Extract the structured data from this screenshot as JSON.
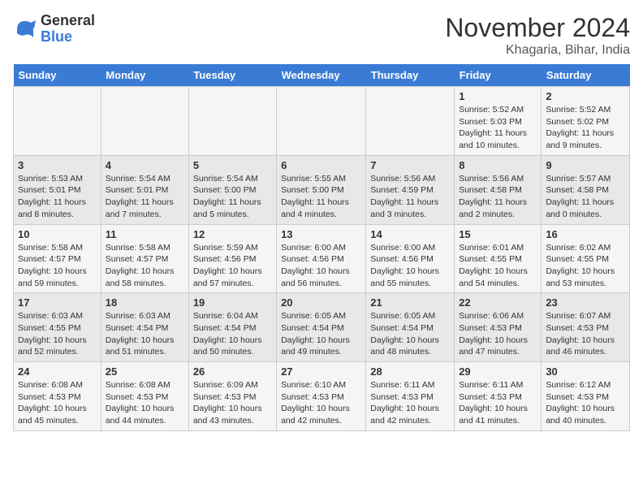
{
  "logo": {
    "general": "General",
    "blue": "Blue"
  },
  "title": "November 2024",
  "location": "Khagaria, Bihar, India",
  "headers": [
    "Sunday",
    "Monday",
    "Tuesday",
    "Wednesday",
    "Thursday",
    "Friday",
    "Saturday"
  ],
  "weeks": [
    [
      {
        "day": "",
        "info": ""
      },
      {
        "day": "",
        "info": ""
      },
      {
        "day": "",
        "info": ""
      },
      {
        "day": "",
        "info": ""
      },
      {
        "day": "",
        "info": ""
      },
      {
        "day": "1",
        "info": "Sunrise: 5:52 AM\nSunset: 5:03 PM\nDaylight: 11 hours and 10 minutes."
      },
      {
        "day": "2",
        "info": "Sunrise: 5:52 AM\nSunset: 5:02 PM\nDaylight: 11 hours and 9 minutes."
      }
    ],
    [
      {
        "day": "3",
        "info": "Sunrise: 5:53 AM\nSunset: 5:01 PM\nDaylight: 11 hours and 8 minutes."
      },
      {
        "day": "4",
        "info": "Sunrise: 5:54 AM\nSunset: 5:01 PM\nDaylight: 11 hours and 7 minutes."
      },
      {
        "day": "5",
        "info": "Sunrise: 5:54 AM\nSunset: 5:00 PM\nDaylight: 11 hours and 5 minutes."
      },
      {
        "day": "6",
        "info": "Sunrise: 5:55 AM\nSunset: 5:00 PM\nDaylight: 11 hours and 4 minutes."
      },
      {
        "day": "7",
        "info": "Sunrise: 5:56 AM\nSunset: 4:59 PM\nDaylight: 11 hours and 3 minutes."
      },
      {
        "day": "8",
        "info": "Sunrise: 5:56 AM\nSunset: 4:58 PM\nDaylight: 11 hours and 2 minutes."
      },
      {
        "day": "9",
        "info": "Sunrise: 5:57 AM\nSunset: 4:58 PM\nDaylight: 11 hours and 0 minutes."
      }
    ],
    [
      {
        "day": "10",
        "info": "Sunrise: 5:58 AM\nSunset: 4:57 PM\nDaylight: 10 hours and 59 minutes."
      },
      {
        "day": "11",
        "info": "Sunrise: 5:58 AM\nSunset: 4:57 PM\nDaylight: 10 hours and 58 minutes."
      },
      {
        "day": "12",
        "info": "Sunrise: 5:59 AM\nSunset: 4:56 PM\nDaylight: 10 hours and 57 minutes."
      },
      {
        "day": "13",
        "info": "Sunrise: 6:00 AM\nSunset: 4:56 PM\nDaylight: 10 hours and 56 minutes."
      },
      {
        "day": "14",
        "info": "Sunrise: 6:00 AM\nSunset: 4:56 PM\nDaylight: 10 hours and 55 minutes."
      },
      {
        "day": "15",
        "info": "Sunrise: 6:01 AM\nSunset: 4:55 PM\nDaylight: 10 hours and 54 minutes."
      },
      {
        "day": "16",
        "info": "Sunrise: 6:02 AM\nSunset: 4:55 PM\nDaylight: 10 hours and 53 minutes."
      }
    ],
    [
      {
        "day": "17",
        "info": "Sunrise: 6:03 AM\nSunset: 4:55 PM\nDaylight: 10 hours and 52 minutes."
      },
      {
        "day": "18",
        "info": "Sunrise: 6:03 AM\nSunset: 4:54 PM\nDaylight: 10 hours and 51 minutes."
      },
      {
        "day": "19",
        "info": "Sunrise: 6:04 AM\nSunset: 4:54 PM\nDaylight: 10 hours and 50 minutes."
      },
      {
        "day": "20",
        "info": "Sunrise: 6:05 AM\nSunset: 4:54 PM\nDaylight: 10 hours and 49 minutes."
      },
      {
        "day": "21",
        "info": "Sunrise: 6:05 AM\nSunset: 4:54 PM\nDaylight: 10 hours and 48 minutes."
      },
      {
        "day": "22",
        "info": "Sunrise: 6:06 AM\nSunset: 4:53 PM\nDaylight: 10 hours and 47 minutes."
      },
      {
        "day": "23",
        "info": "Sunrise: 6:07 AM\nSunset: 4:53 PM\nDaylight: 10 hours and 46 minutes."
      }
    ],
    [
      {
        "day": "24",
        "info": "Sunrise: 6:08 AM\nSunset: 4:53 PM\nDaylight: 10 hours and 45 minutes."
      },
      {
        "day": "25",
        "info": "Sunrise: 6:08 AM\nSunset: 4:53 PM\nDaylight: 10 hours and 44 minutes."
      },
      {
        "day": "26",
        "info": "Sunrise: 6:09 AM\nSunset: 4:53 PM\nDaylight: 10 hours and 43 minutes."
      },
      {
        "day": "27",
        "info": "Sunrise: 6:10 AM\nSunset: 4:53 PM\nDaylight: 10 hours and 42 minutes."
      },
      {
        "day": "28",
        "info": "Sunrise: 6:11 AM\nSunset: 4:53 PM\nDaylight: 10 hours and 42 minutes."
      },
      {
        "day": "29",
        "info": "Sunrise: 6:11 AM\nSunset: 4:53 PM\nDaylight: 10 hours and 41 minutes."
      },
      {
        "day": "30",
        "info": "Sunrise: 6:12 AM\nSunset: 4:53 PM\nDaylight: 10 hours and 40 minutes."
      }
    ]
  ]
}
